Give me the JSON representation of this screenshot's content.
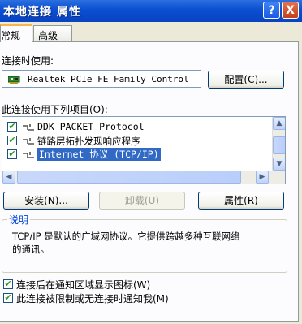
{
  "window": {
    "title": "本地连接 属性",
    "help_button": "?",
    "close_button": "X"
  },
  "tabs": [
    {
      "label": "常规"
    },
    {
      "label": "高级"
    }
  ],
  "connect_using": {
    "label": "连接时使用:",
    "adapter": "Realtek PCIe FE Family Control",
    "configure_button": "配置(C)..."
  },
  "items": {
    "label": "此连接使用下列项目(O):",
    "rows": [
      {
        "checked": true,
        "text": "DDK PACKET Protocol"
      },
      {
        "checked": true,
        "text": "链路层拓扑发现响应程序"
      },
      {
        "checked": true,
        "text": "Internet 协议 (TCP/IP)",
        "selected": true
      }
    ],
    "check_mark": "✔"
  },
  "buttons": {
    "install": "安装(N)...",
    "uninstall": "卸载(U)",
    "properties": "属性(R)"
  },
  "description": {
    "title": "说明",
    "text_line1": "TCP/IP 是默认的广域网协议。它提供跨越多种互联网络",
    "text_line2": "的通讯。"
  },
  "options": [
    {
      "checked": true,
      "label": "连接后在通知区域显示图标(W)"
    },
    {
      "checked": true,
      "label": "此连接被限制或无连接时通知我(M)"
    }
  ],
  "scroll_glyphs": {
    "up": "▲",
    "down": "▼",
    "left": "◀",
    "right": "▶"
  }
}
